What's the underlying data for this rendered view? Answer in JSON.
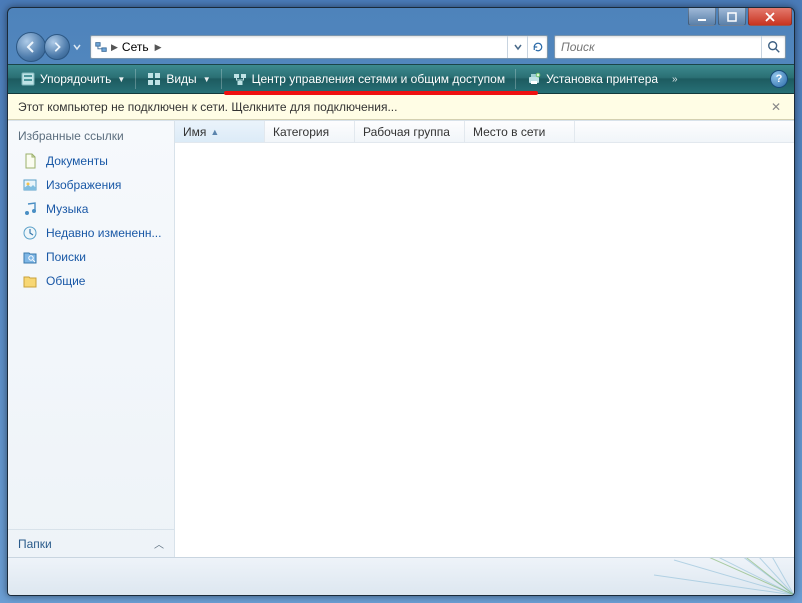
{
  "breadcrumb": {
    "root": "Сеть"
  },
  "search": {
    "placeholder": "Поиск"
  },
  "toolbar": {
    "organize": "Упорядочить",
    "views": "Виды",
    "network_center": "Центр управления сетями и общим доступом",
    "add_printer": "Установка принтера"
  },
  "infobar": {
    "text": "Этот компьютер не подключен к сети. Щелкните для подключения..."
  },
  "sidebar": {
    "title": "Избранные ссылки",
    "items": [
      {
        "label": "Документы",
        "icon": "documents-icon"
      },
      {
        "label": "Изображения",
        "icon": "pictures-icon"
      },
      {
        "label": "Музыка",
        "icon": "music-icon"
      },
      {
        "label": "Недавно измененн...",
        "icon": "recent-icon"
      },
      {
        "label": "Поиски",
        "icon": "searches-icon"
      },
      {
        "label": "Общие",
        "icon": "public-icon"
      }
    ],
    "folders": "Папки"
  },
  "columns": {
    "name": "Имя",
    "category": "Категория",
    "workgroup": "Рабочая группа",
    "location": "Место в сети"
  }
}
